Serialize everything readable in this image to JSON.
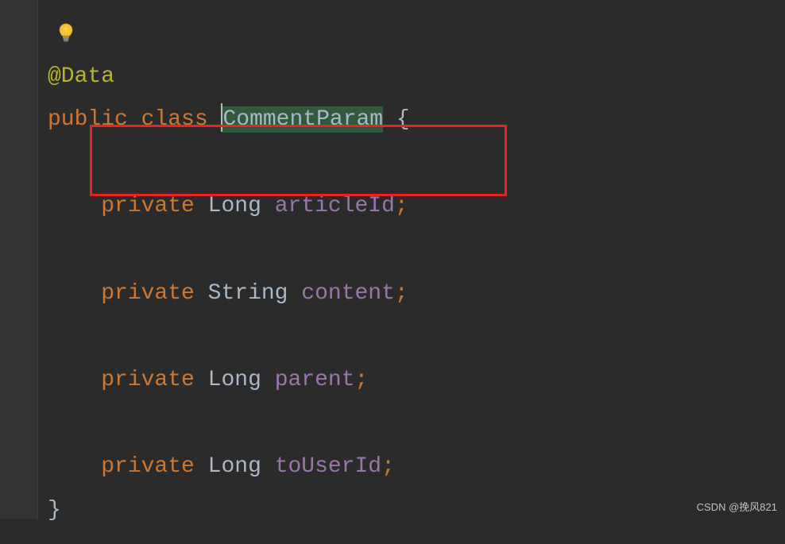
{
  "code": {
    "annotation": "@Data",
    "class_decl": {
      "kw_public": "public",
      "kw_class": "class",
      "class_name": "CommentParam",
      "open_brace": "{",
      "close_brace": "}"
    },
    "fields": [
      {
        "modifier": "private",
        "type": "Long",
        "name": "articleId",
        "semi": ";"
      },
      {
        "modifier": "private",
        "type": "String",
        "name": "content",
        "semi": ";"
      },
      {
        "modifier": "private",
        "type": "Long",
        "name": "parent",
        "semi": ";"
      },
      {
        "modifier": "private",
        "type": "Long",
        "name": "toUserId",
        "semi": ";"
      }
    ]
  },
  "icons": {
    "intention_bulb": "lightbulb"
  },
  "annotations": {
    "red_box_target": "articleId"
  },
  "watermark": "CSDN @挽风821",
  "colors": {
    "bg": "#2b2b2b",
    "gutter": "#313335",
    "keyword": "#cc7832",
    "annotation_color": "#bbb529",
    "field": "#9876aa",
    "text": "#a9b7c6",
    "highlight": "#32593d",
    "red": "#ef2020"
  }
}
